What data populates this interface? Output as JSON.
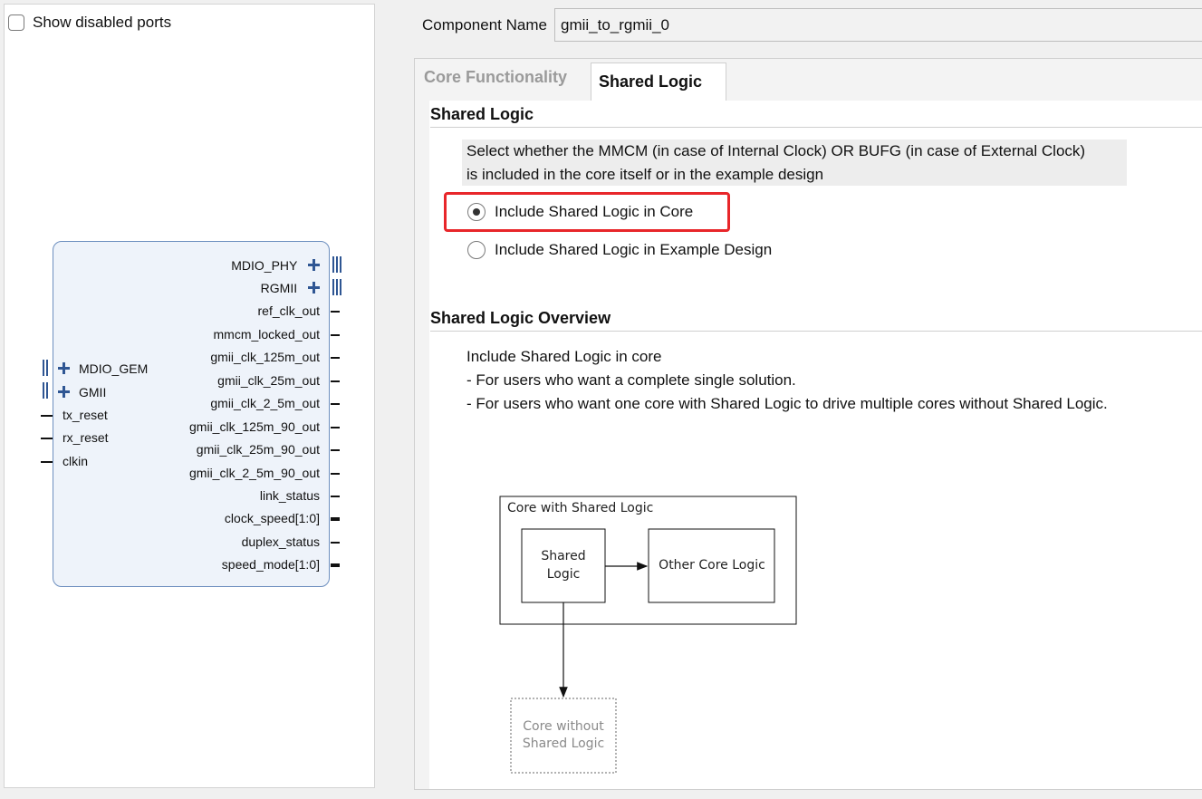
{
  "left": {
    "show_disabled_ports": {
      "label": "Show disabled ports",
      "checked": false
    }
  },
  "ip_block": {
    "right_ports": [
      {
        "name": "MDIO_PHY",
        "kind": "interface"
      },
      {
        "name": "RGMII",
        "kind": "interface"
      },
      {
        "name": "ref_clk_out",
        "kind": "wire"
      },
      {
        "name": "mmcm_locked_out",
        "kind": "wire"
      },
      {
        "name": "gmii_clk_125m_out",
        "kind": "wire"
      },
      {
        "name": "gmii_clk_25m_out",
        "kind": "wire"
      },
      {
        "name": "gmii_clk_2_5m_out",
        "kind": "wire"
      },
      {
        "name": "gmii_clk_125m_90_out",
        "kind": "wire"
      },
      {
        "name": "gmii_clk_25m_90_out",
        "kind": "wire"
      },
      {
        "name": "gmii_clk_2_5m_90_out",
        "kind": "wire"
      },
      {
        "name": "link_status",
        "kind": "wire"
      },
      {
        "name": "clock_speed[1:0]",
        "kind": "bus"
      },
      {
        "name": "duplex_status",
        "kind": "wire"
      },
      {
        "name": "speed_mode[1:0]",
        "kind": "bus"
      }
    ],
    "left_ports": [
      {
        "name": "MDIO_GEM",
        "kind": "interface"
      },
      {
        "name": "GMII",
        "kind": "interface"
      },
      {
        "name": "tx_reset",
        "kind": "wire"
      },
      {
        "name": "rx_reset",
        "kind": "wire"
      },
      {
        "name": "clkin",
        "kind": "wire"
      }
    ]
  },
  "component": {
    "label": "Component Name",
    "value": "gmii_to_rgmii_0"
  },
  "tabs": [
    {
      "label": "Core Functionality",
      "active": false
    },
    {
      "label": "Shared Logic",
      "active": true
    }
  ],
  "shared_logic": {
    "title": "Shared Logic",
    "description": [
      "Select whether the MMCM (in case of Internal Clock) OR BUFG (in case of External Clock)",
      "is included in the core itself or in the example design"
    ],
    "options": [
      {
        "label": "Include Shared Logic in Core",
        "selected": true
      },
      {
        "label": "Include Shared Logic in Example Design",
        "selected": false
      }
    ],
    "highlight_color": "#e8262a"
  },
  "overview": {
    "title": "Shared Logic Overview",
    "lines": [
      "Include Shared Logic in core",
      "- For users who want a complete single solution.",
      "- For users who want one core with Shared Logic to drive multiple cores without Shared Logic."
    ]
  },
  "diagram": {
    "outer_label": "Core with Shared Logic",
    "shared_logic_label": [
      "Shared",
      "Logic"
    ],
    "other_core_label": "Other Core Logic",
    "core_without_label": [
      "Core without",
      "Shared Logic"
    ]
  },
  "colors": {
    "block_fill": "#eef3fa",
    "block_border": "#6d8fbf",
    "interface_blue": "#2f5693"
  }
}
